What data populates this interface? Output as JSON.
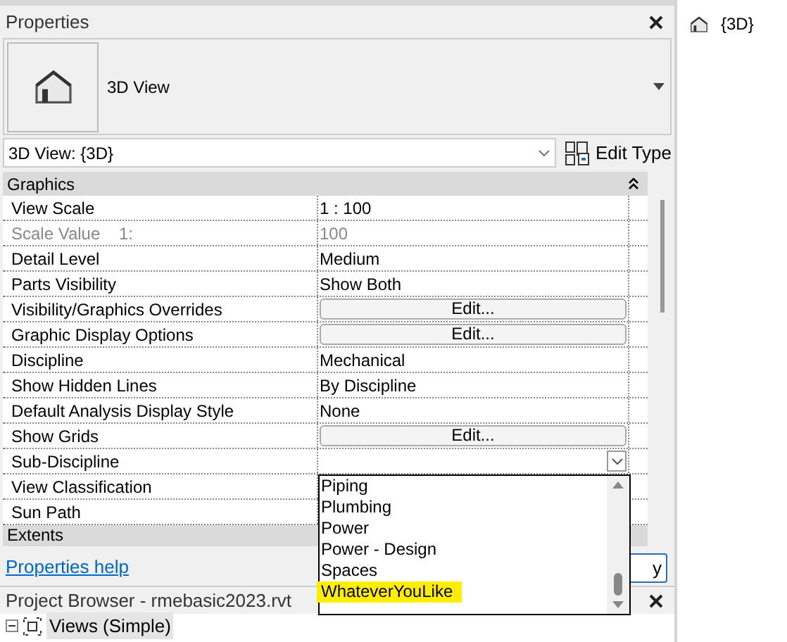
{
  "properties": {
    "title": "Properties",
    "type_name": "3D View",
    "instance": "3D View: {3D}",
    "edit_type": "Edit Type",
    "sections": [
      {
        "title": "Graphics",
        "expanded": true,
        "rows": [
          {
            "name": "View Scale",
            "value": "1 : 100",
            "kind": "text",
            "disabled": false
          },
          {
            "name": "Scale Value    1:",
            "value": "100",
            "kind": "text",
            "disabled": true
          },
          {
            "name": "Detail Level",
            "value": "Medium",
            "kind": "text",
            "disabled": false
          },
          {
            "name": "Parts Visibility",
            "value": "Show Both",
            "kind": "text",
            "disabled": false
          },
          {
            "name": "Visibility/Graphics Overrides",
            "value": "Edit...",
            "kind": "button",
            "disabled": false
          },
          {
            "name": "Graphic Display Options",
            "value": "Edit...",
            "kind": "button",
            "disabled": false
          },
          {
            "name": "Discipline",
            "value": "Mechanical",
            "kind": "text",
            "disabled": false
          },
          {
            "name": "Show Hidden Lines",
            "value": "By Discipline",
            "kind": "text",
            "disabled": false
          },
          {
            "name": "Default Analysis Display Style",
            "value": "None",
            "kind": "text",
            "disabled": false
          },
          {
            "name": "Show Grids",
            "value": "Edit...",
            "kind": "button",
            "disabled": false
          },
          {
            "name": "Sub-Discipline",
            "kind": "dropdown",
            "disabled": false
          },
          {
            "name": "View Classification",
            "kind": "text",
            "disabled": false
          },
          {
            "name": "Sun Path",
            "kind": "text",
            "disabled": false
          }
        ]
      },
      {
        "title": "Extents"
      }
    ],
    "help_link": "Properties help",
    "apply": "y",
    "dropdown_options": [
      {
        "label": "Piping",
        "highlighted": false
      },
      {
        "label": "Plumbing",
        "highlighted": false
      },
      {
        "label": "Power",
        "highlighted": false
      },
      {
        "label": "Power - Design",
        "highlighted": false
      },
      {
        "label": "Spaces",
        "highlighted": false
      },
      {
        "label": "WhateverYouLike",
        "highlighted": true
      }
    ]
  },
  "project_browser": {
    "title": "Project Browser - rmebasic2023.rvt",
    "items": [
      {
        "label": "Views (Simple)",
        "expanded": true
      }
    ]
  },
  "view_tab": {
    "title": "{3D}"
  }
}
